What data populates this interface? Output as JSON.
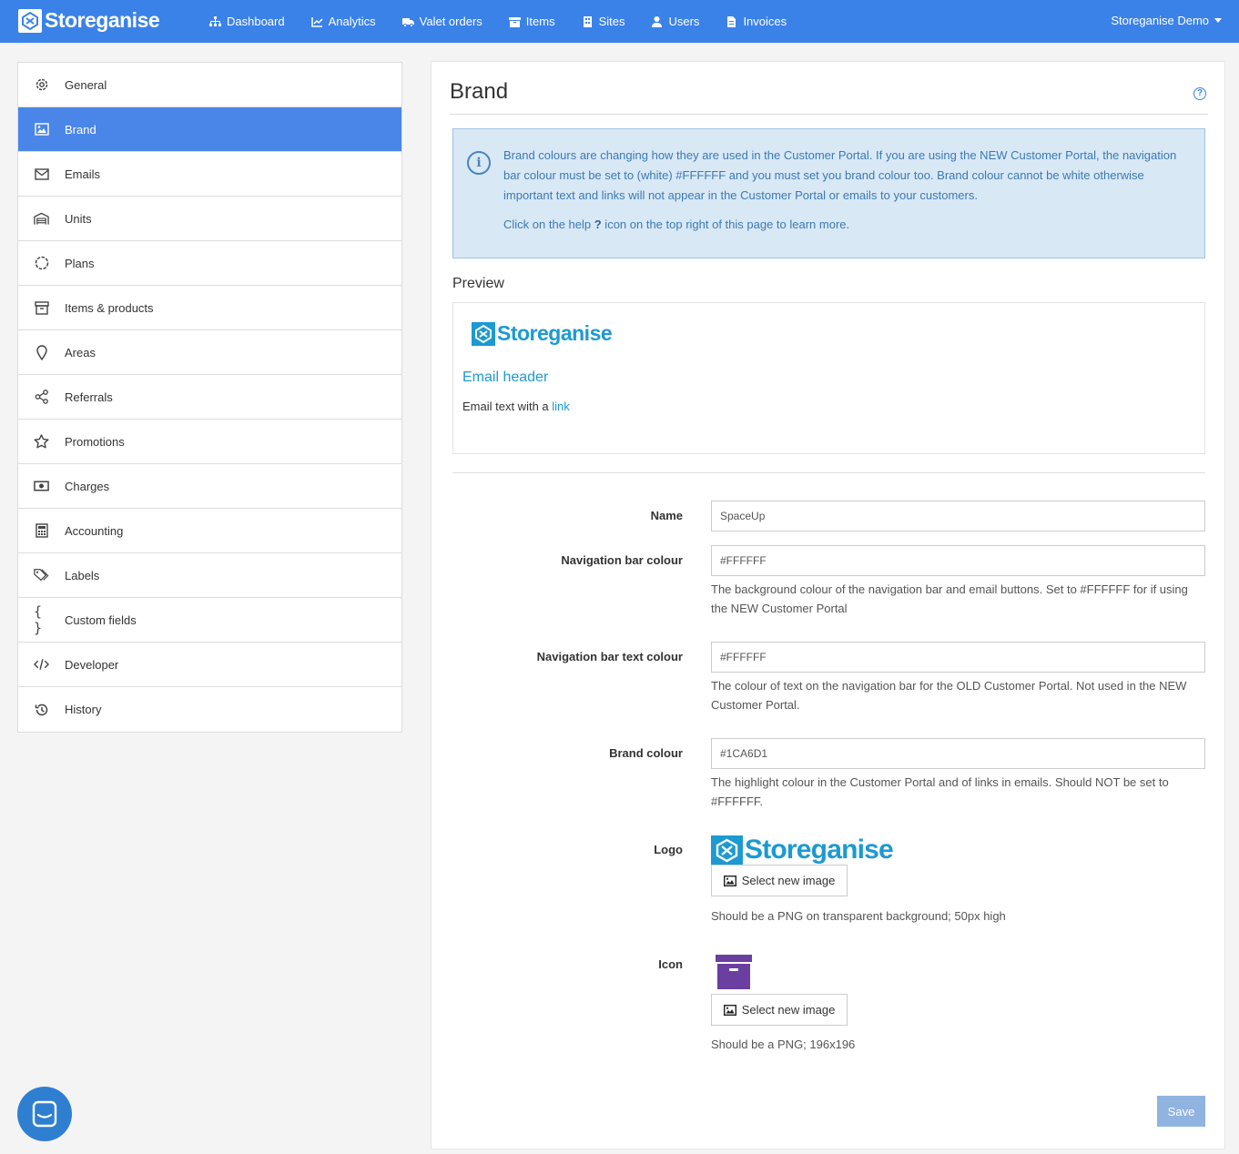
{
  "topnav": {
    "brand": "Storeganise",
    "items": [
      {
        "label": "Dashboard",
        "icon": "sitemap-icon"
      },
      {
        "label": "Analytics",
        "icon": "chart-line-icon"
      },
      {
        "label": "Valet orders",
        "icon": "truck-icon"
      },
      {
        "label": "Items",
        "icon": "box-icon"
      },
      {
        "label": "Sites",
        "icon": "building-icon"
      },
      {
        "label": "Users",
        "icon": "user-icon"
      },
      {
        "label": "Invoices",
        "icon": "file-invoice-icon"
      }
    ],
    "account": "Storeganise Demo",
    "bg_color": "#3b82e8"
  },
  "sidebar": {
    "items": [
      {
        "label": "General",
        "icon": "gear-icon"
      },
      {
        "label": "Brand",
        "icon": "image-icon",
        "active": true
      },
      {
        "label": "Emails",
        "icon": "envelope-icon"
      },
      {
        "label": "Units",
        "icon": "garage-icon"
      },
      {
        "label": "Plans",
        "icon": "circle-dashed-icon"
      },
      {
        "label": "Items & products",
        "icon": "archive-icon"
      },
      {
        "label": "Areas",
        "icon": "map-pin-icon"
      },
      {
        "label": "Referrals",
        "icon": "share-icon"
      },
      {
        "label": "Promotions",
        "icon": "star-icon"
      },
      {
        "label": "Charges",
        "icon": "money-bill-icon"
      },
      {
        "label": "Accounting",
        "icon": "calculator-icon"
      },
      {
        "label": "Labels",
        "icon": "tags-icon"
      },
      {
        "label": "Custom fields",
        "icon": "braces-icon"
      },
      {
        "label": "Developer",
        "icon": "code-icon"
      },
      {
        "label": "History",
        "icon": "history-icon"
      }
    ],
    "active_color": "#4a86e8"
  },
  "main": {
    "title": "Brand",
    "alert": {
      "text1": "Brand colours are changing how they are used in the Customer Portal. If you are using the NEW Customer Portal, the navigation bar colour must be set to (white) #FFFFFF and you must set you brand colour too. Brand colour cannot be white otherwise important text and links will not appear in the Customer Portal or emails to your customers.",
      "text2_pre": "Click on the help ",
      "text2_q": "?",
      "text2_post": " icon on the  top right of this page to learn more."
    },
    "preview": {
      "label": "Preview",
      "logo_text": "Storeganise",
      "email_header": "Email header",
      "email_text": "Email text with a ",
      "email_link": "link"
    },
    "form": {
      "name": {
        "label": "Name",
        "value": "SpaceUp"
      },
      "nav_colour": {
        "label": "Navigation bar colour",
        "value": "#FFFFFF",
        "help": "The background colour of the navigation bar and email buttons. Set to #FFFFFF for if using the NEW Customer Portal"
      },
      "nav_text_colour": {
        "label": "Navigation bar text colour",
        "value": "#FFFFFF",
        "help": "The colour of text on the navigation bar for the OLD Customer Portal. Not used in the NEW Customer Portal."
      },
      "brand_colour": {
        "label": "Brand colour",
        "value": "#1CA6D1",
        "help": "The highlight colour in the Customer Portal and of links in emails. Should NOT be set to #FFFFFF."
      },
      "logo": {
        "label": "Logo",
        "logo_text": "Storeganise",
        "button": "Select new image",
        "help": "Should be a PNG on transparent background; 50px high"
      },
      "icon": {
        "label": "Icon",
        "button": "Select new image",
        "help": "Should be a PNG; 196x196"
      }
    },
    "save": "Save"
  },
  "colors": {
    "brand_blue": "#1c9ad1",
    "icon_purple": "#6b3fa0"
  }
}
